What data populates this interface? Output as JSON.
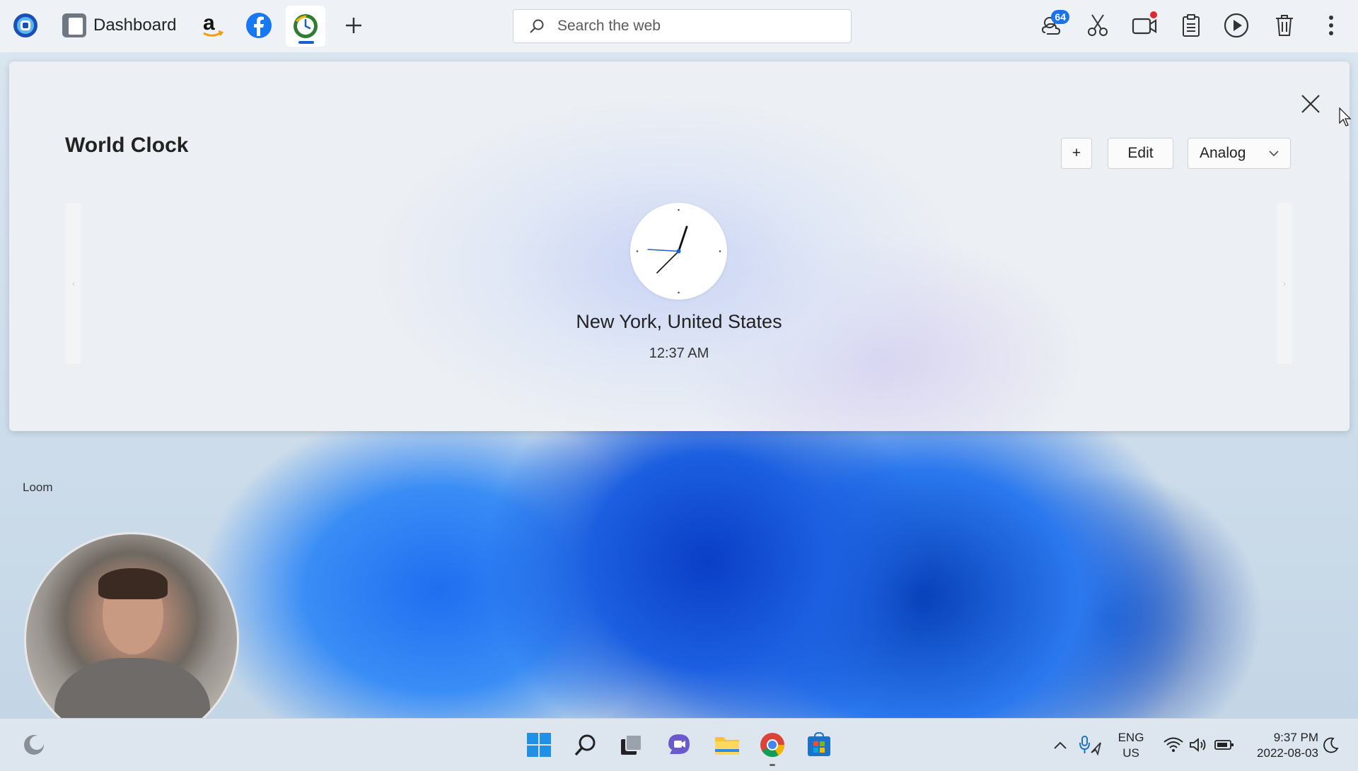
{
  "toolbar": {
    "dashboard_label": "Dashboard",
    "search_placeholder": "Search the web",
    "notification_count": "64"
  },
  "panel": {
    "title": "World Clock",
    "add_label": "+",
    "edit_label": "Edit",
    "view_mode": "Analog"
  },
  "clock": {
    "city": "New York, United States",
    "time": "12:37 AM"
  },
  "desktop": {
    "loom_label": "Loom"
  },
  "tray": {
    "lang": "ENG",
    "region": "US",
    "time": "9:37 PM",
    "date": "2022-08-03"
  },
  "colors": {
    "accent": "#1a5fd0",
    "badge": "#1a73e8",
    "record_dot": "#e0262e"
  },
  "icons": [
    "app-logo-icon",
    "dashboard-icon",
    "amazon-icon",
    "facebook-icon",
    "world-clock-icon",
    "plus-icon",
    "search-icon",
    "weather-icon",
    "scissors-icon",
    "video-camera-icon",
    "clipboard-icon",
    "play-icon",
    "trash-icon",
    "more-icon",
    "close-icon",
    "chevron-down-icon",
    "windows-start-icon",
    "taskbar-search-icon",
    "task-view-icon",
    "teams-chat-icon",
    "file-explorer-icon",
    "chrome-icon",
    "store-icon",
    "chevron-up-icon",
    "mic-icon",
    "wifi-icon",
    "volume-icon",
    "battery-icon",
    "moon-icon"
  ]
}
